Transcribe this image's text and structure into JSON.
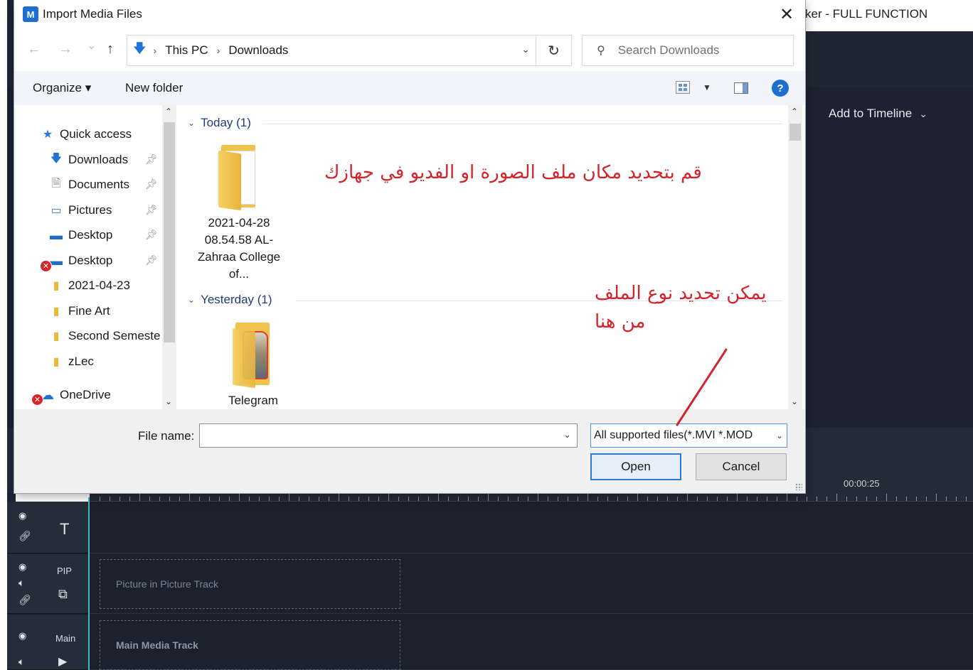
{
  "app": {
    "title": "ker - FULL FUNCTION",
    "add_to_timeline": "Add to Timeline",
    "timecode": "00:00:25",
    "tracks": {
      "text_track_icon": "T",
      "pip_label": "PIP",
      "pip_track": "Picture in Picture Track",
      "main_label": "Main",
      "main_track": "Main Media Track"
    }
  },
  "dialog": {
    "title": "Import Media Files",
    "app_icon": "M",
    "close_icon": "✕",
    "nav": {
      "back": "←",
      "forward": "→",
      "recent": "⌄",
      "up": "↑"
    },
    "address": {
      "segments": [
        "This PC",
        "Downloads"
      ]
    },
    "search": {
      "placeholder": "Search Downloads"
    },
    "toolbar": {
      "organize": "Organize ▾",
      "new_folder": "New folder"
    },
    "sidebar": {
      "items": [
        {
          "label": "Quick access"
        },
        {
          "label": "Downloads"
        },
        {
          "label": "Documents"
        },
        {
          "label": "Pictures"
        },
        {
          "label": "Desktop"
        },
        {
          "label": "Desktop"
        },
        {
          "label": "2021-04-23"
        },
        {
          "label": "Fine Art"
        },
        {
          "label": "Second Semeste"
        },
        {
          "label": "zLec"
        },
        {
          "label": "OneDrive"
        }
      ]
    },
    "groups": [
      {
        "header": "Today (1)",
        "files": [
          {
            "label": "2021-04-28 08.54.58 AL-Zahraa College of..."
          }
        ]
      },
      {
        "header": "Yesterday (1)",
        "files": [
          {
            "label": "Telegram"
          }
        ]
      }
    ],
    "bottom": {
      "filename_label": "File name:",
      "filename_value": "",
      "filetype": "All supported files(*.MVI *.MOD",
      "open": "Open",
      "cancel": "Cancel"
    }
  },
  "annotations": {
    "location_note": "قم بتحديد مكان ملف الصورة او الفديو في جهازك",
    "filetype_note_line1": "يمكن تحديد نوع الملف",
    "filetype_note_line2": "من هنا",
    "color": "#d2242b"
  }
}
